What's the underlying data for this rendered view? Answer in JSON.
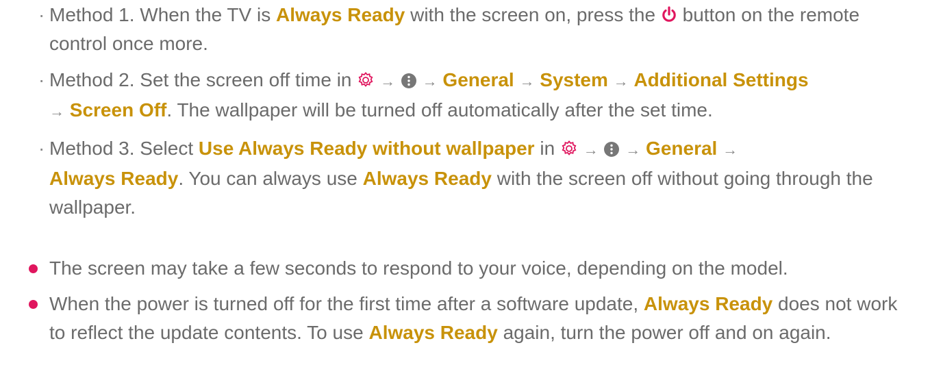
{
  "colors": {
    "text": "#6b6b6b",
    "highlight": "#c8920a",
    "power_icon": "#e0165e",
    "settings_icon": "#e0165e",
    "menu_icon": "#777777",
    "bullet": "#e0165e"
  },
  "icons": {
    "power": "power-icon",
    "settings": "settings-gear-icon",
    "more": "more-menu-icon",
    "arrow": "→"
  },
  "methods": [
    {
      "mark": "·",
      "m1_a": "Method 1. When the TV is ",
      "m1_b": "Always Ready",
      "m1_c": " with the screen on, press the ",
      "m1_d": " button on the remote control once more."
    },
    {
      "mark": "·",
      "m2_a": "Method 2. Set the screen off time in ",
      "m2_general": "General",
      "m2_system": "System",
      "m2_additional": "Additional Settings",
      "m2_screen_off": "Screen Off",
      "m2_end": ". The wallpaper will be turned off automatically after the set time."
    },
    {
      "mark": "·",
      "m3_a": "Method 3. Select ",
      "m3_b": "Use Always Ready without wallpaper",
      "m3_c": " in ",
      "m3_general": "General",
      "m3_always_ready": "Always Ready",
      "m3_d": ". You can always use ",
      "m3_e": "Always Ready",
      "m3_f": " with the screen off without going through the wallpaper."
    }
  ],
  "notes": [
    {
      "text": "The screen may take a few seconds to respond to your voice, depending on the model."
    },
    {
      "n2_a": "When the power is turned off for the first time after a software update, ",
      "n2_b": "Always Ready",
      "n2_c": " does not work to reflect the update contents. To use ",
      "n2_d": "Always Ready",
      "n2_e": " again, turn the power off and on again."
    }
  ]
}
